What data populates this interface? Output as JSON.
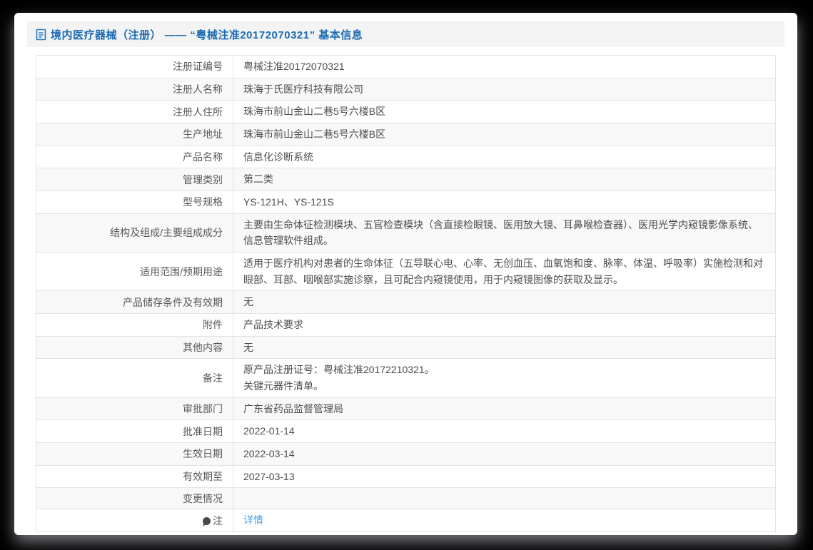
{
  "page": {
    "title": "境内医疗器械（注册） —— “粤械注准20172070321” 基本信息",
    "title_icon": "document-icon"
  },
  "colors": {
    "title_blue": "#1c6bb3",
    "link_blue": "#4d9fe6",
    "header_band": "#f3f3f3",
    "alt_row": "#f8f8f8",
    "table_border": "#e3e3e3"
  },
  "table": {
    "rows": [
      {
        "label": "注册证编号",
        "value": "粤械注准20172070321"
      },
      {
        "label": "注册人名称",
        "value": "珠海于氏医疗科技有限公司"
      },
      {
        "label": "注册人住所",
        "value": "珠海市前山金山二巷5号六楼B区"
      },
      {
        "label": "生产地址",
        "value": "珠海市前山金山二巷5号六楼B区"
      },
      {
        "label": "产品名称",
        "value": "信息化诊断系统"
      },
      {
        "label": "管理类别",
        "value": "第二类"
      },
      {
        "label": "型号规格",
        "value": "YS-121H、YS-121S"
      },
      {
        "label": "结构及组成/主要组成成分",
        "value": "主要由生命体征检测模块、五官检查模块（含直接检眼镜、医用放大镜、耳鼻喉检查器）、医用光学内窥镜影像系统、信息管理软件组成。"
      },
      {
        "label": "适用范围/预期用途",
        "value": "适用于医疗机构对患者的生命体征（五导联心电、心率、无创血压、血氧饱和度、脉率、体温、呼吸率）实施检测和对眼部、耳部、咽喉部实施诊察，且可配合内窥镜使用，用于内窥镜图像的获取及显示。"
      },
      {
        "label": "产品储存条件及有效期",
        "value": "无"
      },
      {
        "label": "附件",
        "value": "产品技术要求"
      },
      {
        "label": "其他内容",
        "value": "无"
      },
      {
        "label": "备注",
        "value": "原产品注册证号：粤械注准20172210321。\n关键元器件清单。"
      },
      {
        "label": "审批部门",
        "value": "广东省药品监督管理局"
      },
      {
        "label": "批准日期",
        "value": "2022-01-14"
      },
      {
        "label": "生效日期",
        "value": "2022-03-14"
      },
      {
        "label": "有效期至",
        "value": "2027-03-13"
      },
      {
        "label": "变更情况",
        "value": ""
      },
      {
        "label": "注",
        "value": "详情",
        "link": true,
        "label_icon": "note-icon"
      }
    ]
  }
}
